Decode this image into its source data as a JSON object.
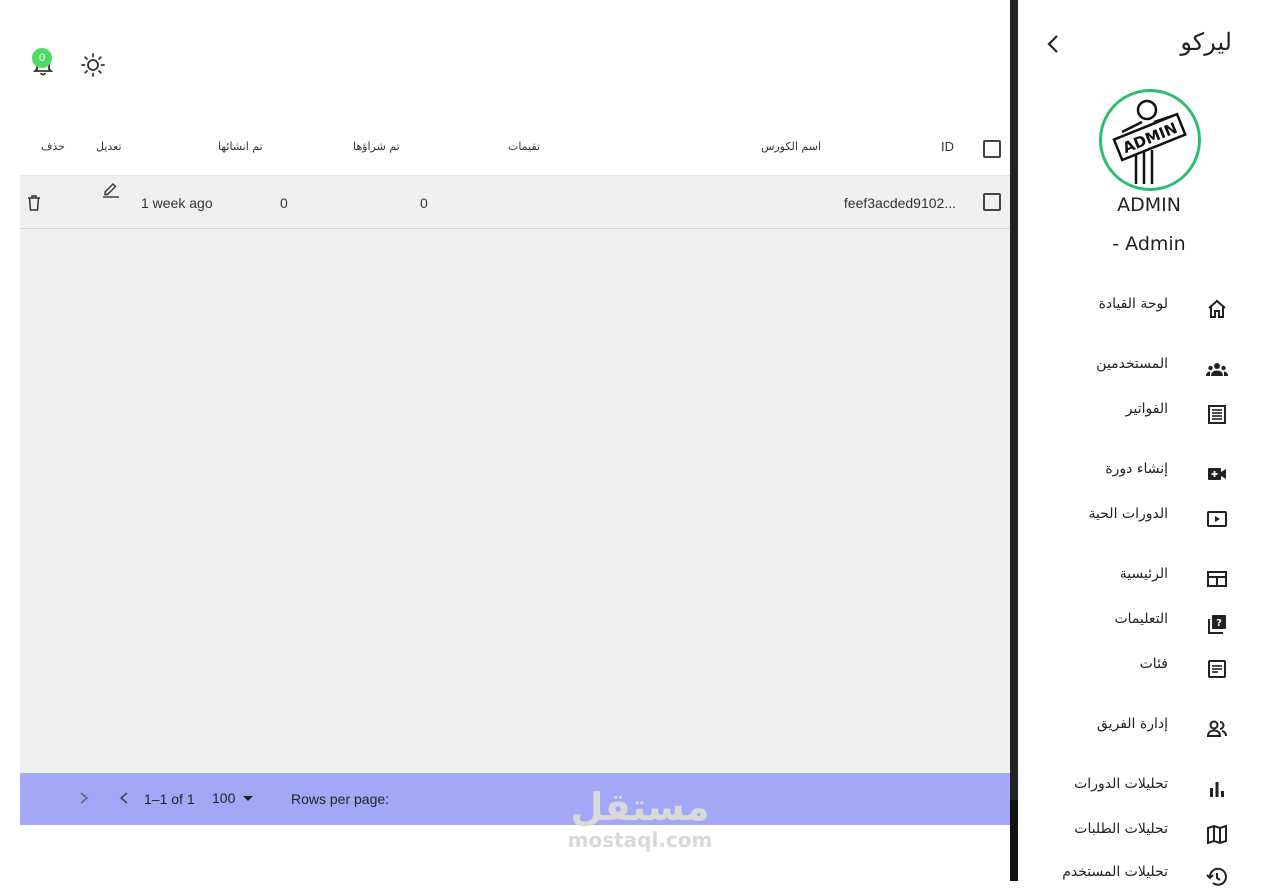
{
  "notifications": {
    "count": "0"
  },
  "table": {
    "headers": {
      "delete": "حذف",
      "edit": "تعديل",
      "created": "تم انشائها",
      "purchased": "تم شراؤها",
      "ratings": "تقيمات",
      "course_name": "اسم الكورس",
      "id": "ID"
    },
    "rows": [
      {
        "id": "feef3acded9102...",
        "course_name": "",
        "ratings": "",
        "purchased": "0",
        "created_count": "0",
        "created_at": "1 week ago"
      }
    ]
  },
  "pagination": {
    "rows_per_page_label": "Rows per page:",
    "rows_per_page_value": "100",
    "range": "1–1 of 1"
  },
  "sidebar": {
    "brand": "ليركو",
    "avatar_text": "ADMIN",
    "user_name": "ADMIN",
    "user_role": "- Admin",
    "items": [
      {
        "label": "لوحة القيادة",
        "icon": "home-icon"
      },
      {
        "label": "المستخدمين",
        "icon": "users-icon"
      },
      {
        "label": "الفواتير",
        "icon": "receipt-icon"
      },
      {
        "label": "إنشاء دورة",
        "icon": "video-add-icon"
      },
      {
        "label": "الدورات الحية",
        "icon": "live-video-icon"
      },
      {
        "label": "الرئيسية",
        "icon": "web-layout-icon"
      },
      {
        "label": "التعليمات",
        "icon": "help-library-icon"
      },
      {
        "label": "فئات",
        "icon": "article-icon"
      },
      {
        "label": "إدارة الفريق",
        "icon": "team-icon"
      },
      {
        "label": "تحليلات الدورات",
        "icon": "bar-chart-icon"
      },
      {
        "label": "تحليلات الطلبات",
        "icon": "map-icon"
      },
      {
        "label": "تحليلات المستخدم",
        "icon": "history-icon"
      }
    ]
  },
  "watermark": {
    "arabic": "مستقل",
    "latin": "mostaql.com"
  }
}
